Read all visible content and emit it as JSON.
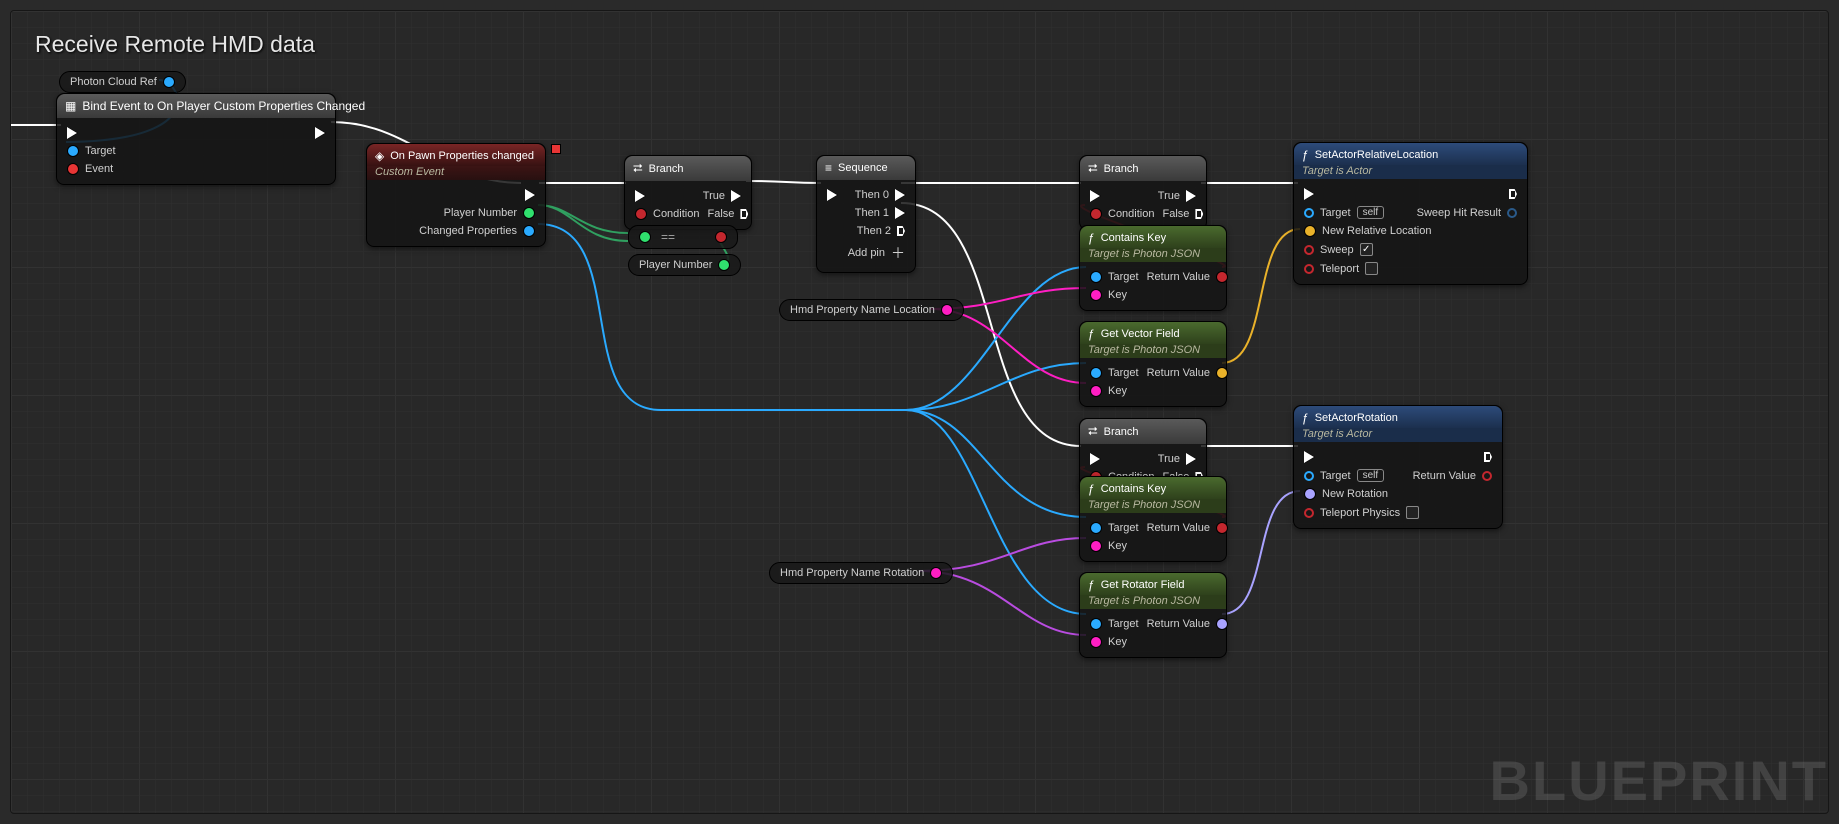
{
  "commentTitle": "Receive Remote HMD data",
  "photonCloudRef": "Photon Cloud Ref",
  "bindEvent": {
    "title": "Bind Event to On Player Custom Properties Changed",
    "target": "Target",
    "event": "Event"
  },
  "customEvent": {
    "title": "On Pawn Properties changed",
    "subtitle": "Custom Event",
    "playerNumber": "Player Number",
    "changedProperties": "Changed Properties"
  },
  "branch": {
    "title": "Branch",
    "condition": "Condition",
    "true": "True",
    "false": "False"
  },
  "sequence": {
    "title": "Sequence",
    "then0": "Then 0",
    "then1": "Then 1",
    "then2": "Then 2",
    "addPin": "Add pin"
  },
  "playerNumberPill": "Player Number",
  "hmdLocationPill": "Hmd Property Name Location",
  "hmdRotationPill": "Hmd Property Name Rotation",
  "containsKey": {
    "title": "Contains Key",
    "subtitle": "Target is Photon JSON",
    "target": "Target",
    "key": "Key",
    "returnValue": "Return Value"
  },
  "getVectorField": {
    "title": "Get Vector Field",
    "subtitle": "Target is Photon JSON",
    "target": "Target",
    "key": "Key",
    "returnValue": "Return Value"
  },
  "getRotatorField": {
    "title": "Get Rotator Field",
    "subtitle": "Target is Photon JSON",
    "target": "Target",
    "key": "Key",
    "returnValue": "Return Value"
  },
  "setActorRelativeLocation": {
    "title": "SetActorRelativeLocation",
    "subtitle": "Target is Actor",
    "target": "Target",
    "self": "self",
    "newRelLocation": "New Relative Location",
    "sweep": "Sweep",
    "teleport": "Teleport",
    "sweepHitResult": "Sweep Hit Result"
  },
  "setActorRotation": {
    "title": "SetActorRotation",
    "subtitle": "Target is Actor",
    "target": "Target",
    "self": "self",
    "newRotation": "New Rotation",
    "teleportPhysics": "Teleport Physics",
    "returnValue": "Return Value"
  },
  "eqSymbol": "==",
  "watermark": "BLUEPRINT"
}
